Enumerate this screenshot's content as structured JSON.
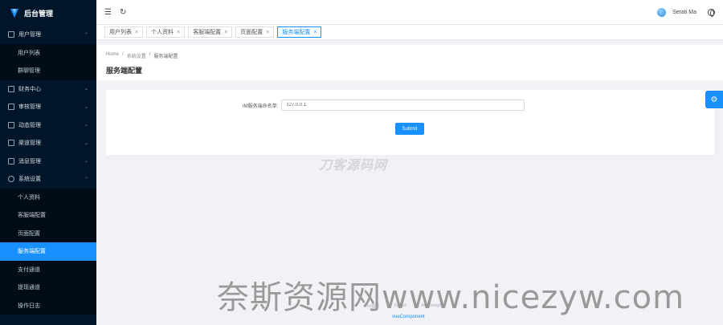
{
  "app": {
    "title": "后台管理"
  },
  "sidebar": {
    "groups": [
      {
        "label": "用户管理",
        "icon": "grid-icon",
        "expanded": true,
        "items": [
          "用户列表",
          "群聊管理"
        ]
      },
      {
        "label": "财务中心",
        "icon": "wallet-icon",
        "expanded": false
      },
      {
        "label": "审核管理",
        "icon": "check-icon",
        "expanded": false
      },
      {
        "label": "动态管理",
        "icon": "feed-icon",
        "expanded": false
      },
      {
        "label": "渠道管理",
        "icon": "channel-icon",
        "expanded": false
      },
      {
        "label": "消息管理",
        "icon": "message-icon",
        "expanded": false
      },
      {
        "label": "系统设置",
        "icon": "gear-icon",
        "expanded": true,
        "items": [
          "个人资料",
          "客服端配置",
          "页面配置",
          "服务端配置",
          "支付通道",
          "提现通道",
          "操作日志"
        ]
      }
    ],
    "active_item": "服务端配置"
  },
  "header": {
    "user_name": "Serati Ma"
  },
  "tabs": [
    {
      "label": "用户列表",
      "active": false
    },
    {
      "label": "个人资料",
      "active": false
    },
    {
      "label": "客服端配置",
      "active": false
    },
    {
      "label": "页面配置",
      "active": false
    },
    {
      "label": "服务端配置",
      "active": true
    }
  ],
  "breadcrumb": {
    "home": "Home",
    "parent": "系统设置",
    "current": "服务端配置"
  },
  "page": {
    "title": "服务端配置"
  },
  "form": {
    "label": "IM服务端命名单:",
    "value": "127.0.0.1",
    "submit_label": "Submit"
  },
  "watermark": {
    "center": "刀客源码网",
    "bottom": "奈斯资源网www.nicezyw.com"
  },
  "footer": {
    "links": [
      "Pro首页",
      "GitHub",
      "Ant Design"
    ],
    "brand": "vueComponent"
  },
  "colors": {
    "primary": "#1890ff",
    "sidebar_bg": "#001529",
    "submenu_bg": "#000c17"
  }
}
